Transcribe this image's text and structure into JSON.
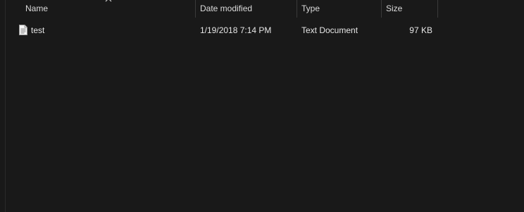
{
  "columns": {
    "name": "Name",
    "date_modified": "Date modified",
    "type": "Type",
    "size": "Size"
  },
  "files": [
    {
      "name": "test",
      "date_modified": "1/19/2018 7:14 PM",
      "type": "Text Document",
      "size": "97 KB",
      "icon": "text-file-icon"
    }
  ]
}
